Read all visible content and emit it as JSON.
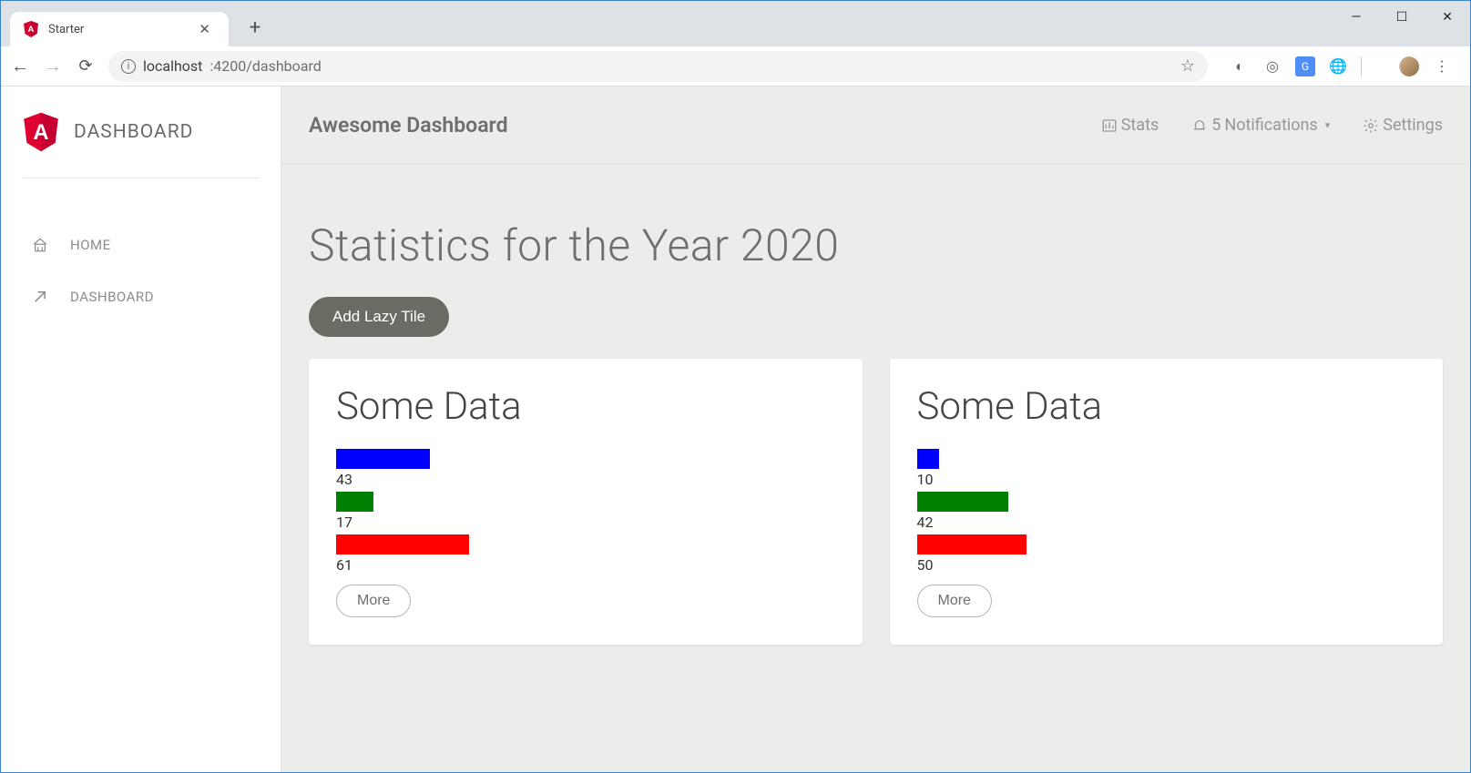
{
  "browser": {
    "tab_title": "Starter",
    "url_host": "localhost",
    "url_port_path": ":4200/dashboard"
  },
  "sidebar": {
    "brand": "DASHBOARD",
    "items": [
      {
        "label": "HOME"
      },
      {
        "label": "DASHBOARD"
      }
    ]
  },
  "topbar": {
    "title": "Awesome Dashboard",
    "stats": "Stats",
    "notif_count": "5",
    "notif_label": "Notifications",
    "settings": "Settings"
  },
  "page": {
    "heading": "Statistics for the Year 2020",
    "add_btn": "Add Lazy Tile"
  },
  "tiles": [
    {
      "title": "Some Data",
      "more": "More",
      "bars": [
        {
          "value": 43,
          "color": "#0000ff"
        },
        {
          "value": 17,
          "color": "#008000"
        },
        {
          "value": 61,
          "color": "#ff0000"
        }
      ]
    },
    {
      "title": "Some Data",
      "more": "More",
      "bars": [
        {
          "value": 10,
          "color": "#0000ff"
        },
        {
          "value": 42,
          "color": "#008000"
        },
        {
          "value": 50,
          "color": "#ff0000"
        }
      ]
    }
  ],
  "chart_data": [
    {
      "type": "bar",
      "title": "Some Data",
      "categories": [
        "blue",
        "green",
        "red"
      ],
      "values": [
        43,
        17,
        61
      ],
      "xlabel": "",
      "ylabel": "",
      "ylim": [
        0,
        100
      ]
    },
    {
      "type": "bar",
      "title": "Some Data",
      "categories": [
        "blue",
        "green",
        "red"
      ],
      "values": [
        10,
        42,
        50
      ],
      "xlabel": "",
      "ylabel": "",
      "ylim": [
        0,
        100
      ]
    }
  ]
}
